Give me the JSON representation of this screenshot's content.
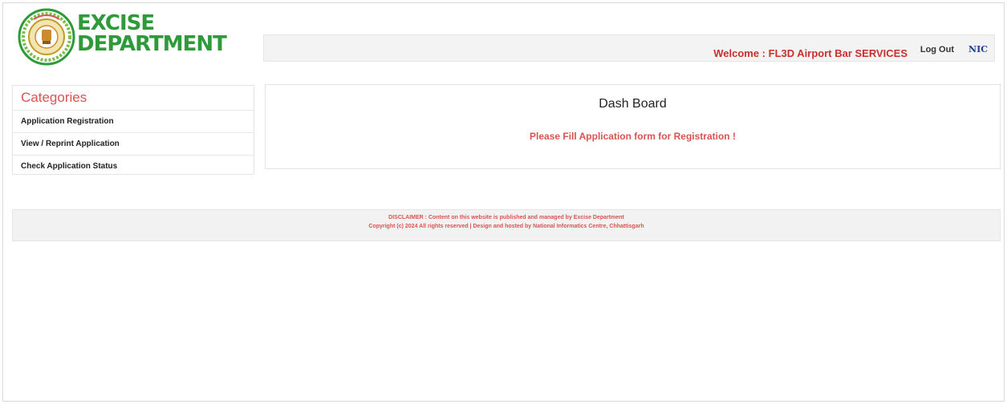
{
  "header": {
    "logo_line1": "EXCISE",
    "logo_line2": "DEPARTMENT",
    "welcome_text": "Welcome : FL3D Airport Bar SERVICES",
    "logout_label": "Log Out",
    "nic_label": "NIC"
  },
  "sidebar": {
    "title": "Categories",
    "items": [
      {
        "label": "Application Registration"
      },
      {
        "label": "View / Reprint Application"
      },
      {
        "label": "Check Application Status"
      }
    ]
  },
  "main": {
    "title": "Dash Board",
    "message": "Please Fill Application form for Registration !"
  },
  "footer": {
    "disclaimer": "DISCLAIMER : Content on this website is published and managed by Excise Department",
    "copyright": "Copyright (c) 2024 All rights reserved | Design and hosted by National Informatics Centre, Chhattisgarh"
  },
  "colors": {
    "accent_red": "#d9534f",
    "logo_green": "#2e9a3a",
    "nic_blue": "#1f3f8f"
  },
  "icons": {
    "logo": "state-emblem-icon"
  }
}
